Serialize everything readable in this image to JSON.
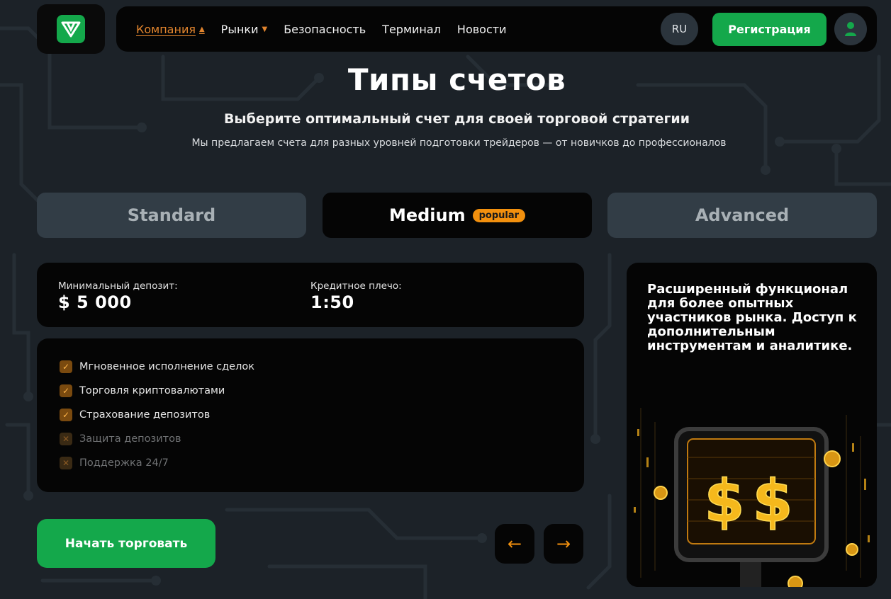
{
  "header": {
    "nav": [
      {
        "label": "Компания",
        "active": true,
        "has_caret": true
      },
      {
        "label": "Рынки",
        "active": false,
        "has_caret": true
      },
      {
        "label": "Безопасность",
        "active": false,
        "has_caret": false
      },
      {
        "label": "Терминал",
        "active": false,
        "has_caret": false
      },
      {
        "label": "Новости",
        "active": false,
        "has_caret": false
      }
    ],
    "lang": "RU",
    "register_label": "Регистрация"
  },
  "main": {
    "title": "Типы счетов",
    "subtitle": "Выберите оптимальный счет для своей торговой стратегии",
    "description": "Мы предлагаем счета для разных уровней подготовки трейдеров — от новичков до профессионалов",
    "tabs": [
      {
        "label": "Standard",
        "active": false
      },
      {
        "label": "Medium",
        "active": true,
        "badge": "popular"
      },
      {
        "label": "Advanced",
        "active": false
      }
    ],
    "stats": {
      "deposit_label": "Минимальный депозит:",
      "deposit_value": "$ 5 000",
      "leverage_label": "Кредитное плечо:",
      "leverage_value": "1:50"
    },
    "features": [
      {
        "label": "Мгновенное исполнение сделок",
        "enabled": true
      },
      {
        "label": "Торговля криптовалютами",
        "enabled": true
      },
      {
        "label": "Страхование депозитов",
        "enabled": true
      },
      {
        "label": "Защита депозитов",
        "enabled": false
      },
      {
        "label": "Поддержка 24/7",
        "enabled": false
      }
    ],
    "start_label": "Начать торговать",
    "promo_text": "Расширенный функционал для более опытных участников рынка. Доступ к дополнительным инструментам и аналитике.",
    "promo_image_icon": "dollar-monitor-illustration"
  },
  "colors": {
    "brand_green": "#14a84b",
    "accent_orange": "#f2900e",
    "background": "#1c2228",
    "card": "#050505",
    "inactive_tab": "#323d46"
  }
}
